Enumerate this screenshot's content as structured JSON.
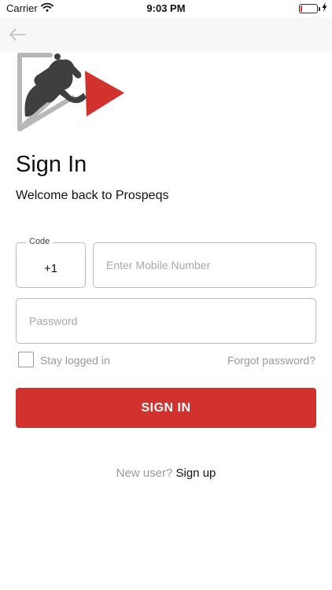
{
  "status_bar": {
    "carrier": "Carrier",
    "time": "9:03 PM",
    "battery_level": 0.1,
    "battery_color": "#e02a2a",
    "icons": [
      "wifi-icon",
      "battery-icon",
      "charging-bolt-icon"
    ]
  },
  "nav": {
    "back_icon": "back-arrow-icon"
  },
  "logo": {
    "icon": "horse-jumper-play-logo",
    "colors": {
      "frame": "#b7b7b7",
      "rider": "#3f3f3f",
      "play": "#d2322d"
    }
  },
  "header": {
    "title": "Sign In",
    "subtitle": "Welcome back to Prospeqs"
  },
  "form": {
    "code_label": "Code",
    "code_value": "+1",
    "mobile_placeholder": "Enter Mobile Number",
    "password_placeholder": "Password",
    "stay_logged_in": "Stay logged in",
    "stay_logged_in_checked": false,
    "forgot_password": "Forgot password?",
    "submit_label": "SIGN IN"
  },
  "footer": {
    "new_user": "New user?",
    "sign_up": "Sign up"
  },
  "colors": {
    "accent": "#d2322d",
    "muted_text": "#9a9a9a",
    "border": "#bdbdbd"
  }
}
